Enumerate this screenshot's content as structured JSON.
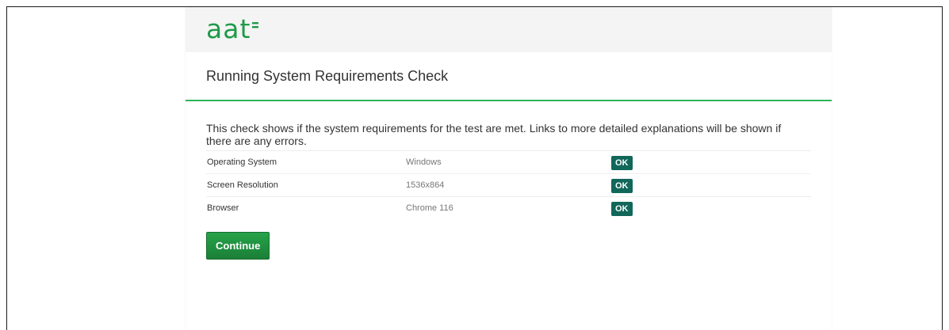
{
  "brand": {
    "logo_text": "aat",
    "color": "#1f9a4a"
  },
  "page": {
    "title": "Running System Requirements Check",
    "intro": "This check shows if the system requirements for the test are met. Links to more detailed explanations will be shown if there are any errors."
  },
  "requirements": [
    {
      "name": "Operating System",
      "value": "Windows",
      "status": "OK"
    },
    {
      "name": "Screen Resolution",
      "value": "1536x864",
      "status": "OK"
    },
    {
      "name": "Browser",
      "value": "Chrome 116",
      "status": "OK"
    }
  ],
  "actions": {
    "continue_label": "Continue"
  },
  "colors": {
    "accent": "#2fb35a",
    "ok_badge": "#11675a",
    "button": "#1e8d3d"
  }
}
